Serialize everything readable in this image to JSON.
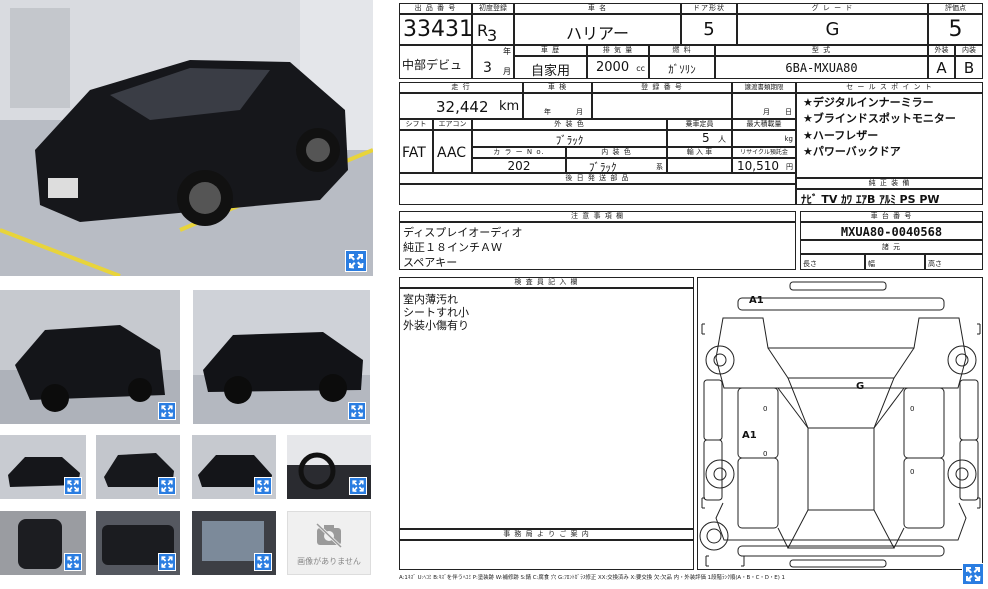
{
  "gallery": {
    "no_image_text": "画像がありません"
  },
  "sheet": {
    "labels": {
      "lot_no": "出 品 番 号",
      "first_reg": "初度登録",
      "car_name": "車 名",
      "door": "ドア形状",
      "grade": "グ レ ー ド",
      "score": "評価点",
      "year_unit": "年",
      "month_unit": "月",
      "history": "車 歴",
      "displacement": "排 気 量",
      "fuel": "燃 料",
      "model_code": "型 式",
      "exterior": "外装",
      "interior": "内装",
      "mileage": "走 行",
      "inspection": "車 検",
      "registration_no": "登 録 番 号",
      "transfer_deadline": "譲渡書類期限",
      "sales_points": "セ ー ル ス ポ イ ン ト",
      "shift": "シフト",
      "ac": "エアコン",
      "ext_color": "外 装 色",
      "capacity": "乗車定員",
      "max_load": "最大積載量",
      "color_no": "カ ラ ー N o.",
      "int_color": "内 装 色",
      "import": "輸 入 車",
      "recycle": "リサイクル預託金",
      "later_parts": "後 日 発 送 部 品",
      "equipment": "純 正 装 備",
      "notes": "注 意 事 項 欄",
      "chassis_no": "車 台 番 号",
      "dimensions": "諸 元",
      "length": "長さ",
      "width": "幅",
      "height": "高さ",
      "inspector": "検 査 員 記 入 欄",
      "office": "事 務 局 よ り ご 案 内",
      "km_unit": "km",
      "cc_unit": "cc",
      "person_unit": "人",
      "kg_unit": "kg",
      "yen_unit": "円",
      "year_m": "年",
      "month_m": "月",
      "day_m": "日",
      "kei_unit": "系"
    },
    "lot_no": "33431",
    "era": "R",
    "year": "3",
    "month": "3",
    "car_name": "ハリアー",
    "doors": "5",
    "grade": "G",
    "score": "5",
    "debut": "中部デビュ",
    "history": "自家用",
    "displacement": "2000",
    "fuel": "ｶﾞｿﾘﾝ",
    "model_code": "6BA-MXUA80",
    "exterior_grade": "A",
    "interior_grade": "B",
    "mileage": "32,442",
    "shift": "FAT",
    "ac": "AAC",
    "ext_color": "ﾌﾞﾗｯｸ",
    "capacity": "5",
    "color_no": "202",
    "int_color": "ﾌﾞﾗｯｸ",
    "recycle_fee": "10,510",
    "sales_points": [
      "★デジタルインナーミラー",
      "★ブラインドスポットモニター",
      "★ハーフレザー",
      "★パワーバックドア"
    ],
    "equipment": "ﾅﾋﾞ TV ｶﾜ ｴｱB ｱﾙﾐ PS PW",
    "notes": [
      "ディスプレイオーディオ",
      "純正１８インチＡＷ",
      "スペアキー"
    ],
    "chassis_no": "MXUA80-0040568",
    "inspector_notes": [
      "室内薄汚れ",
      "シートすれ小",
      "外装小傷有り"
    ],
    "diagram_marks": {
      "a1_top": "A1",
      "g_mark": "G",
      "a1_mid": "A1",
      "zero_1": "0",
      "zero_2": "0",
      "zero_3": "0",
      "zero_4": "0"
    },
    "legend": "A:1ｷｽﾞ U:ﾍｺﾐ B:ｷｽﾞを伴うﾍｺﾐ P:塗装跡 W:補修跡 S:錆 C:腐食 穴 G:ﾌﾛﾝﾄｶﾞﾗｽ修正 XX:交換済み X:要交換 欠:欠品 内・外装評価 1段階ﾗﾝｸ順(A・B・C・D・E) 1"
  }
}
